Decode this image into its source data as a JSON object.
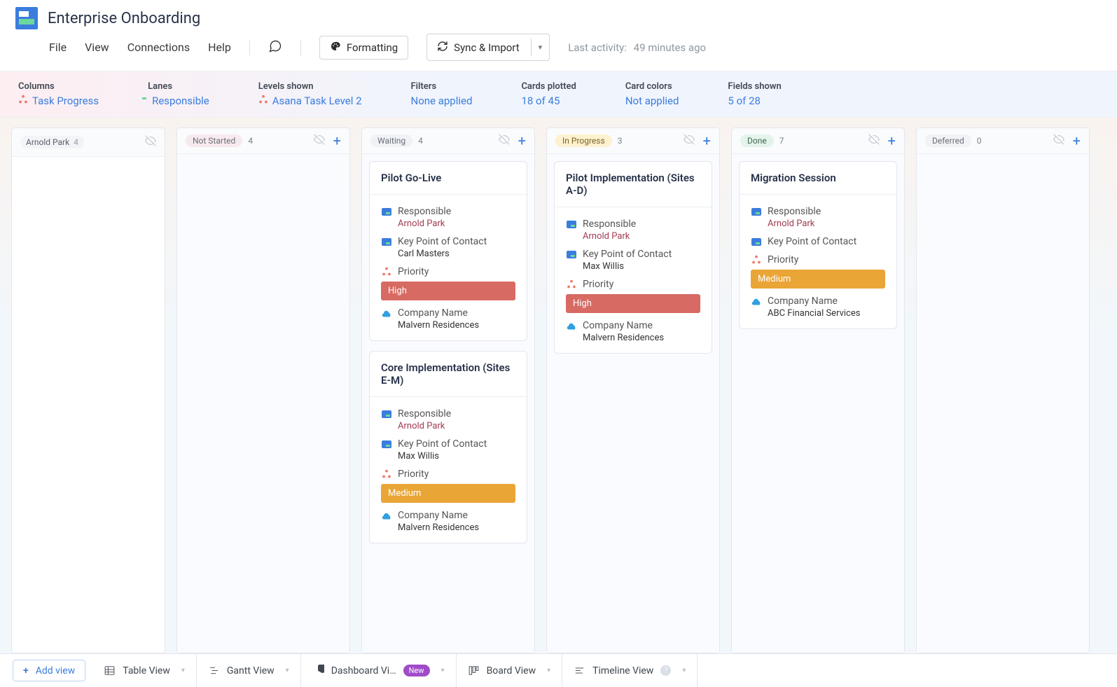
{
  "header": {
    "title": "Enterprise Onboarding",
    "menus": {
      "file": "File",
      "view": "View",
      "connections": "Connections",
      "help": "Help"
    },
    "formatting_btn": "Formatting",
    "sync_btn": "Sync & Import",
    "last_activity_label": "Last activity:",
    "last_activity_value": "49 minutes ago"
  },
  "filters": {
    "columns": {
      "label": "Columns",
      "value": "Task Progress"
    },
    "lanes": {
      "label": "Lanes",
      "value": "Responsible"
    },
    "levels": {
      "label": "Levels shown",
      "value": "Asana Task Level 2"
    },
    "filters": {
      "label": "Filters",
      "value": "None applied"
    },
    "cards_plotted": {
      "label": "Cards plotted",
      "value": "18 of 45"
    },
    "card_colors": {
      "label": "Card colors",
      "value": "Not applied"
    },
    "fields_shown": {
      "label": "Fields shown",
      "value": "5 of 28"
    }
  },
  "lane": {
    "name": "Arnold Park",
    "count": "4"
  },
  "columns": [
    {
      "key": "not_started",
      "name": "Not Started",
      "count": "4",
      "badge_class": "bg-notstarted"
    },
    {
      "key": "waiting",
      "name": "Waiting",
      "count": "4",
      "badge_class": "bg-waiting"
    },
    {
      "key": "in_progress",
      "name": "In Progress",
      "count": "3",
      "badge_class": "bg-inprogress"
    },
    {
      "key": "done",
      "name": "Done",
      "count": "7",
      "badge_class": "bg-done"
    },
    {
      "key": "deferred",
      "name": "Deferred",
      "count": "0",
      "badge_class": "bg-deferred"
    }
  ],
  "field_labels": {
    "responsible": "Responsible",
    "kpoc": "Key Point of Contact",
    "priority": "Priority",
    "company": "Company Name"
  },
  "cards": {
    "waiting": [
      {
        "title": "Pilot Go-Live",
        "responsible": "Arnold Park",
        "kpoc": "Carl Masters",
        "priority": "High",
        "priority_class": "prio-high",
        "company": "Malvern Residences"
      },
      {
        "title": "Core Implementation (Sites E-M)",
        "responsible": "Arnold Park",
        "kpoc": "Max Willis",
        "priority": "Medium",
        "priority_class": "prio-medium",
        "company": "Malvern Residences"
      }
    ],
    "in_progress": [
      {
        "title": "Pilot Implementation (Sites A-D)",
        "responsible": "Arnold Park",
        "kpoc": "Max Willis",
        "priority": "High",
        "priority_class": "prio-high",
        "company": "Malvern Residences"
      }
    ],
    "done": [
      {
        "title": "Migration Session",
        "responsible": "Arnold Park",
        "kpoc": "",
        "priority": "Medium",
        "priority_class": "prio-medium",
        "company": "ABC Financial Services"
      }
    ]
  },
  "views": {
    "add": "Add view",
    "table": "Table View",
    "gantt": "Gantt View",
    "dashboard": "Dashboard Vi…",
    "dashboard_new": "New",
    "board": "Board View",
    "timeline": "Timeline View"
  }
}
